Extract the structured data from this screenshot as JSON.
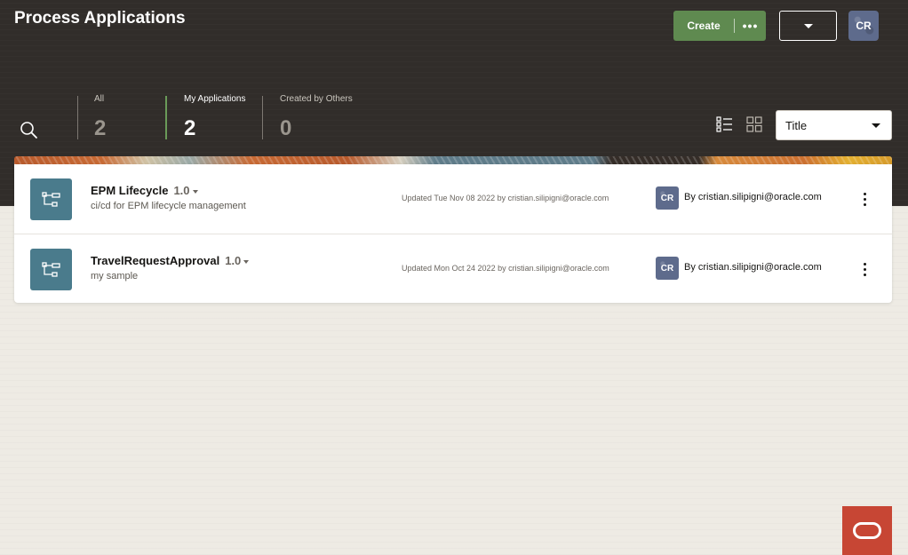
{
  "header": {
    "title": "Process Applications",
    "create_label": "Create",
    "more_label": "•••",
    "user_initials": "CR"
  },
  "filters": [
    {
      "label": "All",
      "count": "2"
    },
    {
      "label": "My Applications",
      "count": "2"
    },
    {
      "label": "Created by Others",
      "count": "0"
    }
  ],
  "sort": {
    "selected": "Title"
  },
  "applications": [
    {
      "name": "EPM Lifecycle",
      "version": "1.0",
      "description": "ci/cd for EPM lifecycle management",
      "updated": "Updated Tue Nov 08 2022 by cristian.silipigni@oracle.com",
      "owner_initials": "CR",
      "owner": "By cristian.silipigni@oracle.com"
    },
    {
      "name": "TravelRequestApproval",
      "version": "1.0",
      "description": "my sample",
      "updated": "Updated Mon Oct 24 2022 by cristian.silipigni@oracle.com",
      "owner_initials": "CR",
      "owner": "By cristian.silipigni@oracle.com"
    }
  ],
  "colors": {
    "header_bg": "#312d2a",
    "create_button": "#5f8a50",
    "app_icon": "#4a7b8c",
    "oracle_red": "#c74634",
    "active_tab_divider": "#6a9a58"
  }
}
